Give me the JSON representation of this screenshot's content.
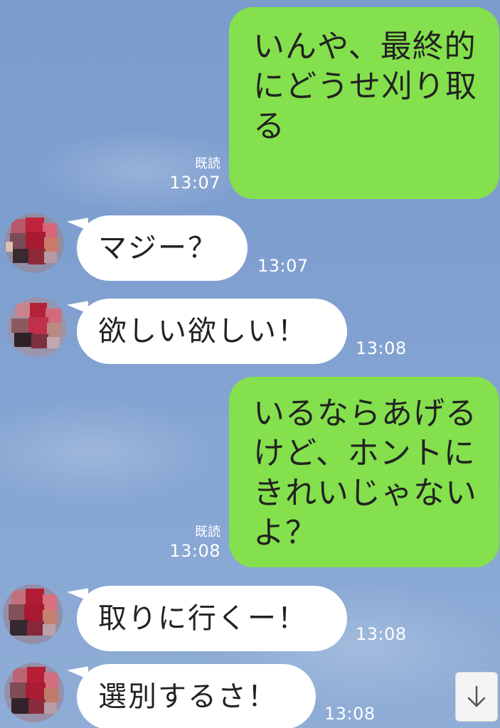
{
  "messages": [
    {
      "side": "out",
      "text": "いんや、最終的にどうせ刈り取る",
      "read": "既読",
      "time": "13:07"
    },
    {
      "side": "in",
      "text": "マジー？",
      "time": "13:07"
    },
    {
      "side": "in",
      "text": "欲しい欲しい！",
      "time": "13:08"
    },
    {
      "side": "out",
      "text": "いるならあげるけど、ホントにきれいじゃないよ？",
      "read": "既読",
      "time": "13:08"
    },
    {
      "side": "in",
      "text": "取りに行くー！",
      "time": "13:08"
    },
    {
      "side": "in",
      "text": "選別するさ！",
      "time": "13:08"
    }
  ],
  "colors": {
    "background": "#7f9fd0",
    "outgoing_bubble": "#84e04c",
    "incoming_bubble": "#ffffff",
    "meta_text": "#ffffff"
  },
  "icons": {
    "scroll_down": "down-arrow-icon",
    "avatar": "blurred-avatar"
  }
}
